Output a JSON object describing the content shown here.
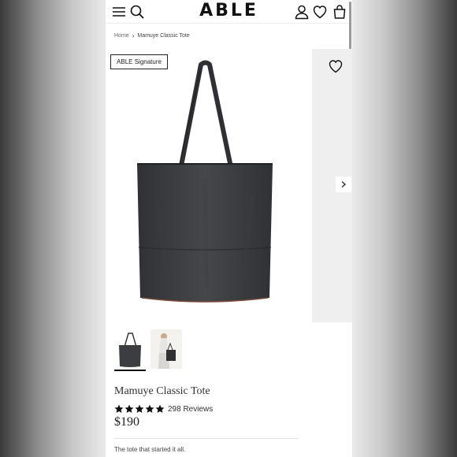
{
  "header": {
    "logo": "ABLE",
    "icons": [
      "menu-icon",
      "search-icon",
      "account-icon",
      "wishlist-icon",
      "bag-icon"
    ]
  },
  "breadcrumb": {
    "home": "Home",
    "current": "Mamuye Classic Tote"
  },
  "gallery": {
    "badge": "ABLE Signature",
    "thumbnail_count": 2,
    "active_thumbnail": 1
  },
  "product": {
    "name": "Mamuye Classic Tote",
    "rating_stars": 5,
    "reviews": "298 Reviews",
    "price": "$190",
    "tagline": "The tote that started it all."
  },
  "colors": {
    "bag": "#3b3d40",
    "text": "#222222",
    "panel": "#efefef"
  }
}
